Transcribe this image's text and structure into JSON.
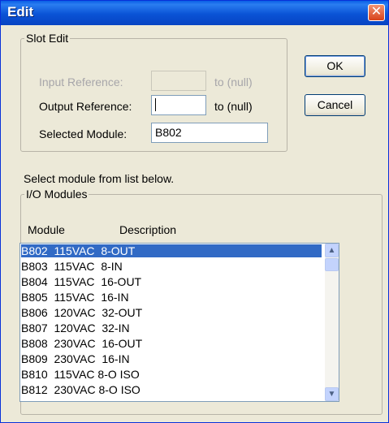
{
  "window": {
    "title": "Edit",
    "close_glyph": "✕"
  },
  "slot_edit": {
    "legend": "Slot Edit",
    "input_ref_label": "Input Reference:",
    "input_ref_value": "",
    "input_ref_suffix": "to (null)",
    "output_ref_label": "Output Reference:",
    "output_ref_value": "",
    "output_ref_suffix": "to (null)",
    "selected_module_label": "Selected Module:",
    "selected_module_value": "B802"
  },
  "buttons": {
    "ok": "OK",
    "cancel": "Cancel"
  },
  "instruction": "Select module from list below.",
  "io_modules": {
    "legend": "I/O Modules",
    "col_module": "Module",
    "col_description": "Description",
    "selected_index": 0,
    "rows": [
      "B802  115VAC  8-OUT",
      "B803  115VAC  8-IN",
      "B804  115VAC  16-OUT",
      "B805  115VAC  16-IN",
      "B806  120VAC  32-OUT",
      "B807  120VAC  32-IN",
      "B808  230VAC  16-OUT",
      "B809  230VAC  16-IN",
      "B810  115VAC 8-O ISO",
      "B812  230VAC 8-O ISO"
    ]
  },
  "scrollbar": {
    "up_icon": "▲",
    "down_icon": "▼"
  }
}
